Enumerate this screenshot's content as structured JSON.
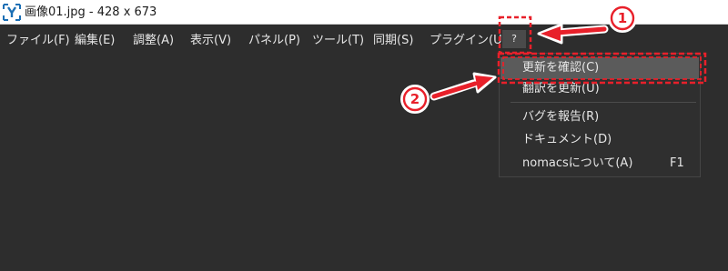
{
  "window": {
    "title": "画像01.jpg  - 428 x 673"
  },
  "menubar": {
    "items": [
      {
        "label": "ファイル(F)"
      },
      {
        "label": "編集(E)"
      },
      {
        "label": "調整(A)"
      },
      {
        "label": "表示(V)"
      },
      {
        "label": "パネル(P)"
      },
      {
        "label": "ツール(T)"
      },
      {
        "label": "同期(S)"
      },
      {
        "label": "プラグイン(U)"
      },
      {
        "label": "?"
      }
    ]
  },
  "help_menu": {
    "items": [
      {
        "label": "更新を確認(C)",
        "shortcut": "",
        "highlighted": true
      },
      {
        "label": "翻訳を更新(U)",
        "shortcut": ""
      },
      {
        "label": "バグを報告(R)",
        "shortcut": ""
      },
      {
        "label": "ドキュメント(D)",
        "shortcut": ""
      },
      {
        "label": "nomacsについて(A)",
        "shortcut": "F1"
      }
    ]
  },
  "annotations": {
    "step1": "①",
    "step2": "②",
    "accent_color": "#e8202a"
  },
  "icons": {
    "app": "nomacs-app-icon",
    "arrow": "pointer-arrow-icon"
  }
}
